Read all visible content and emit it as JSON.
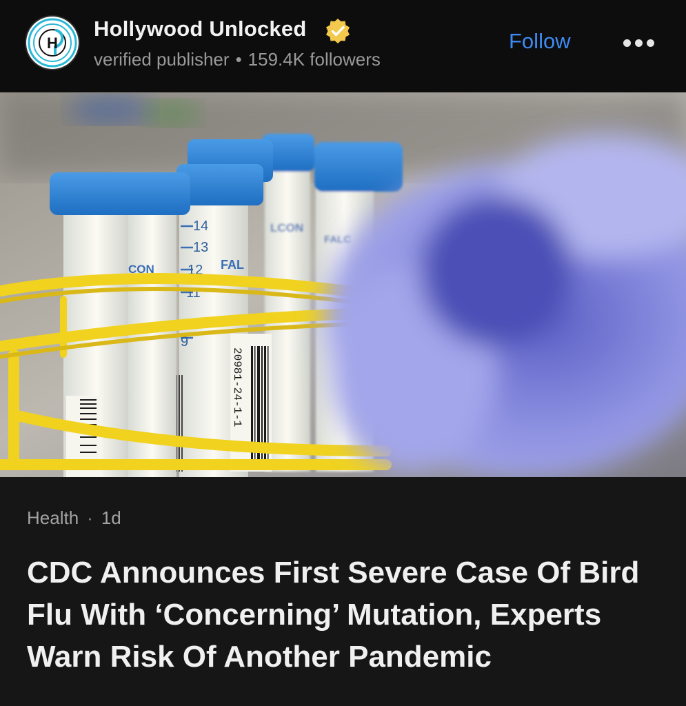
{
  "publisher": {
    "name": "Hollywood Unlocked",
    "logo_letter": "H",
    "verified_icon": "verified-badge-icon",
    "verified_label": "verified publisher",
    "separator": "•",
    "followers": "159.4K followers"
  },
  "actions": {
    "follow_label": "Follow",
    "more_icon": "more-options-icon"
  },
  "image_labels": {
    "tube_marks": [
      "14",
      "13",
      "12",
      "11",
      "9"
    ],
    "brand_fragments": [
      "CON",
      "FAL",
      "LCON",
      "FALC"
    ],
    "barcode_text": "20981-24-1-1"
  },
  "article": {
    "category": "Health",
    "separator": "·",
    "age": "1d",
    "headline": "CDC Announces First Severe Case Of Bird Flu With ‘Concerning’ Mutation, Experts Warn Risk Of Another Pandemic"
  },
  "colors": {
    "accent": "#3d8bf2",
    "verified": "#f2c94c",
    "background": "#161616",
    "header_background": "#0d0d0d"
  }
}
